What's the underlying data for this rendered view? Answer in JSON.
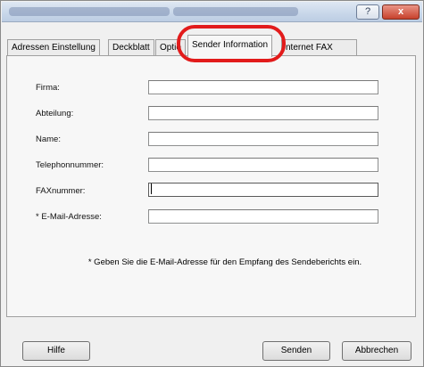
{
  "window": {
    "help_glyph": "?",
    "close_glyph": "x"
  },
  "tabs": [
    {
      "label": "Adressen Einstellung"
    },
    {
      "label": "Deckblatt"
    },
    {
      "label": "Optio"
    },
    {
      "label": "Sender Information",
      "active": true
    },
    {
      "label": "nternet FAX"
    }
  ],
  "form": {
    "fields": [
      {
        "label": "Firma:",
        "value": ""
      },
      {
        "label": "Abteilung:",
        "value": ""
      },
      {
        "label": "Name:",
        "value": ""
      },
      {
        "label": "Telephonnummer:",
        "value": ""
      },
      {
        "label": "FAXnummer:",
        "value": ""
      },
      {
        "label": "* E-Mail-Adresse:",
        "value": ""
      }
    ],
    "note": "* Geben Sie die E-Mail-Adresse für den Empfang des Sendeberichts ein."
  },
  "buttons": {
    "help": "Hilfe",
    "send": "Senden",
    "cancel": "Abbrechen"
  },
  "colors": {
    "highlight": "#e21b1b"
  }
}
